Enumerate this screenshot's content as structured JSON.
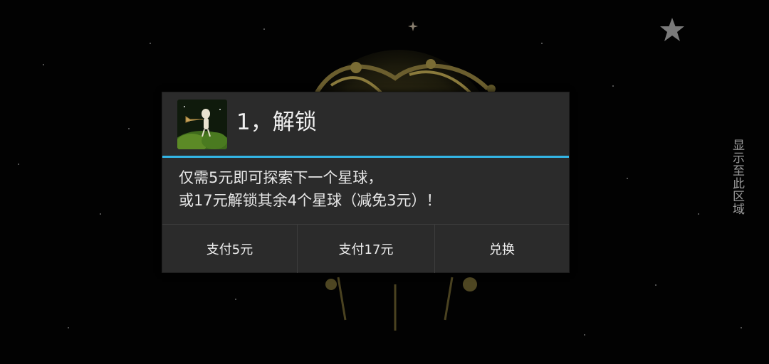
{
  "background": {
    "color": "#020202",
    "star_icon": "star-icon",
    "spark_icon": "sparkle-icon"
  },
  "side_label": "显示至此区域",
  "dialog": {
    "title": "1，解锁",
    "icon": "app-icon",
    "accent_color": "#33b5e5",
    "message_line1": "仅需5元即可探索下一个星球，",
    "message_line2": "或17元解锁其余4个星球（减免3元）！",
    "buttons": {
      "pay5": "支付5元",
      "pay17": "支付17元",
      "redeem": "兑换"
    }
  }
}
